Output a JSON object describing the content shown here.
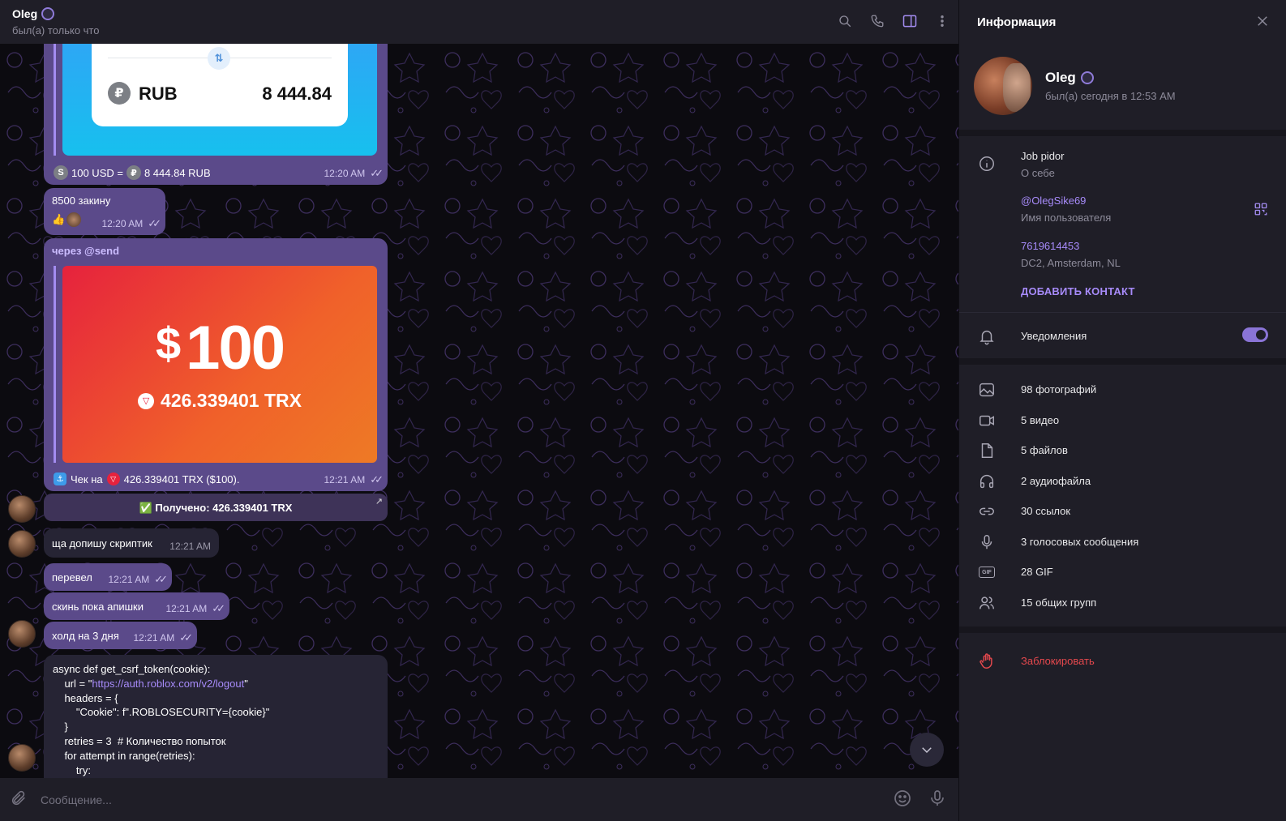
{
  "chat": {
    "name": "Oleg",
    "status": "был(а) только что",
    "header_icons": [
      "search-icon",
      "phone-icon",
      "sidebar-toggle-icon",
      "more-vertical-icon"
    ]
  },
  "messages": {
    "rub_card": {
      "currency": "RUB",
      "amount": "8 444.84",
      "symbol": "₽",
      "swap": "⇅"
    },
    "conv": {
      "usd": "100 USD =",
      "rub": "8 444.84 RUB",
      "time": "12:20 AM",
      "coin_usd": "S",
      "coin_rub": "₽"
    },
    "m1": {
      "text": "8500 закину",
      "time": "12:20 AM",
      "reaction": "👍"
    },
    "via": "через @send",
    "trx_card": {
      "dollar": "$",
      "amount": "100",
      "trx": "426.339401 TRX"
    },
    "check": {
      "prefix": "Чек на",
      "value": "426.339401 TRX ($100).",
      "time": "12:21 AM"
    },
    "received": "✅ Получено: 426.339401 TRX",
    "m2": {
      "text": "ща допишу скриптик",
      "time": "12:21 AM"
    },
    "m3": {
      "text": "перевел",
      "time": "12:21 AM"
    },
    "m4": {
      "text": "скинь пока апишки",
      "time": "12:21 AM"
    },
    "m5": {
      "text": "холд на 3 дня",
      "time": "12:21 AM"
    },
    "code": {
      "l1": "async def get_csrf_token(cookie):",
      "l2a": "    url = \"",
      "l2url": "https://auth.roblox.com/v2/logout",
      "l2b": "\"",
      "l3": "    headers = {",
      "l4": "        \"Cookie\": f\".ROBLOSECURITY={cookie}\"",
      "l5": "    }",
      "l6": "    retries = 3  # Количество попыток",
      "l7": "    for attempt in range(retries):",
      "l8": "        try:"
    }
  },
  "composer": {
    "placeholder": "Сообщение..."
  },
  "panel": {
    "title": "Информация",
    "name": "Oleg",
    "last_seen": "был(а) сегодня в 12:53 AM",
    "bio": "Job pidor",
    "bio_label": "О себе",
    "username": "@OlegSike69",
    "username_label": "Имя пользователя",
    "phone": "7619614453",
    "dc": "DC2, Amsterdam, NL",
    "add_contact": "ДОБАВИТЬ КОНТАКТ",
    "notifications": "Уведомления",
    "notifications_on": true,
    "media": {
      "photos": "98 фотографий",
      "videos": "5 видео",
      "files": "5 файлов",
      "audio": "2 аудиофайла",
      "links": "30 ссылок",
      "voice": "3 голосовых сообщения",
      "gif": "28 GIF",
      "groups": "15 общих групп"
    },
    "gif_badge": "GIF",
    "block": "Заблокировать"
  },
  "colors": {
    "accent": "#8a74d6",
    "outgoing": "#5b4a8a",
    "incoming": "#262434",
    "danger": "#e5484d"
  }
}
